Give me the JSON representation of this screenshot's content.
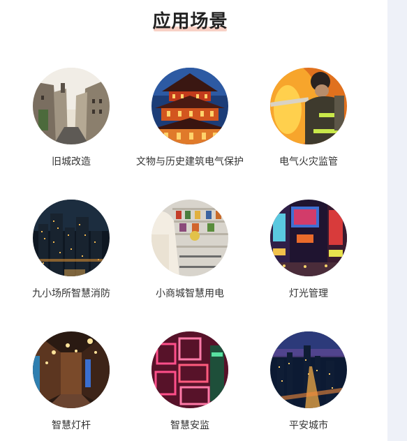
{
  "section": {
    "title": "应用场景"
  },
  "scenarios": [
    {
      "label": "旧城改造",
      "image": "old-city-street-photo"
    },
    {
      "label": "文物与历史建筑电气保护",
      "image": "historic-pagoda-night-photo"
    },
    {
      "label": "电气火灾监管",
      "image": "firefighter-flames-photo"
    },
    {
      "label": "九小场所智慧消防",
      "image": "city-skyline-night-photo"
    },
    {
      "label": "小商城智慧用电",
      "image": "supermarket-shopping-photo"
    },
    {
      "label": "灯光管理",
      "image": "neon-street-lights-photo"
    },
    {
      "label": "智慧灯杆",
      "image": "street-lamps-alley-photo"
    },
    {
      "label": "智慧安监",
      "image": "neon-signs-photo"
    },
    {
      "label": "平安城市",
      "image": "aerial-city-night-photo"
    }
  ],
  "colors": {
    "title": "#222222",
    "title_underline": "#f4b9a7",
    "label": "#333333",
    "right_strip": "#eef1f8"
  }
}
